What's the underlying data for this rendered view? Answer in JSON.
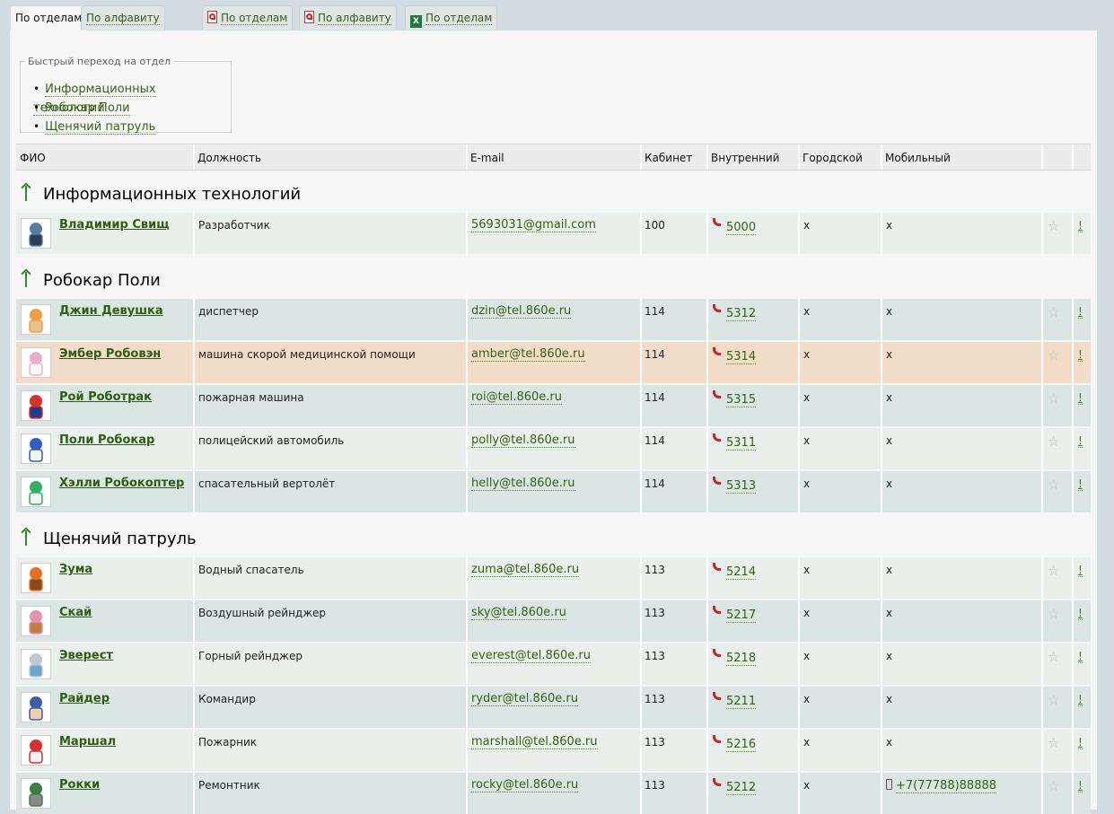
{
  "tabs": [
    {
      "label": "По отделам",
      "active": true
    },
    {
      "label": "По алфавиту"
    },
    {
      "label": "По отделам",
      "icon": "pdf-icon"
    },
    {
      "label": "По алфавиту",
      "icon": "pdf-icon"
    },
    {
      "label": "По отделам",
      "icon": "excel-icon"
    }
  ],
  "quick_nav": {
    "legend": "Быстрый переход на отдел",
    "items": [
      "Информационных технологий",
      "Робокар Поли",
      "Щенячий патруль"
    ]
  },
  "columns": [
    "ФИО",
    "Должность",
    "E-mail",
    "Кабинет",
    "Внутренний",
    "Городской",
    "Мобильный"
  ],
  "departments": [
    {
      "name": "Информационных технологий",
      "people": [
        {
          "name": "Владимир Свищ",
          "position": "Разработчик",
          "email": "5693031@gmail.com",
          "room": "100",
          "ext": "5000",
          "city": "x",
          "mobile": "x"
        }
      ]
    },
    {
      "name": "Робокар Поли",
      "people": [
        {
          "name": "Джин Девушка",
          "position": "диспетчер",
          "email": "dzin@tel.860e.ru",
          "room": "114",
          "ext": "5312",
          "city": "x",
          "mobile": "x"
        },
        {
          "name": "Эмбер Робовэн",
          "position": "машина скорой медицинской помощи",
          "email": "amber@tel.860e.ru",
          "room": "114",
          "ext": "5314",
          "city": "x",
          "mobile": "x"
        },
        {
          "name": "Рой Роботрак",
          "position": "пожарная машина",
          "email": "roi@tel.860e.ru",
          "room": "114",
          "ext": "5315",
          "city": "x",
          "mobile": "x"
        },
        {
          "name": "Поли Робокар",
          "position": "полицейский автомобиль",
          "email": "polly@tel.860e.ru",
          "room": "114",
          "ext": "5311",
          "city": "x",
          "mobile": "x"
        },
        {
          "name": "Хэлли Робокоптер",
          "position": "спасательный вертолёт",
          "email": "helly@tel.860e.ru",
          "room": "114",
          "ext": "5313",
          "city": "x",
          "mobile": "x"
        }
      ]
    },
    {
      "name": "Щенячий патруль",
      "people": [
        {
          "name": "Зума",
          "position": "Водный спасатель",
          "email": "zuma@tel.860e.ru",
          "room": "113",
          "ext": "5214",
          "city": "x",
          "mobile": "x"
        },
        {
          "name": "Скай",
          "position": "Воздушный рейнджер",
          "email": "sky@tel.860e.ru",
          "room": "113",
          "ext": "5217",
          "city": "x",
          "mobile": "x"
        },
        {
          "name": "Эверест",
          "position": "Горный рейнджер",
          "email": "everest@tel.860e.ru",
          "room": "113",
          "ext": "5218",
          "city": "x",
          "mobile": "x"
        },
        {
          "name": "Райдер",
          "position": "Командир",
          "email": "ryder@tel.860e.ru",
          "room": "113",
          "ext": "5211",
          "city": "x",
          "mobile": "x"
        },
        {
          "name": "Маршал",
          "position": "Пожарник",
          "email": "marshall@tel.860e.ru",
          "room": "113",
          "ext": "5216",
          "city": "x",
          "mobile": "x"
        },
        {
          "name": "Рокки",
          "position": "Ремонтник",
          "email": "rocky@tel.860e.ru",
          "room": "113",
          "ext": "5212",
          "city": "x",
          "mobile": "+7(77788)88888"
        }
      ]
    }
  ],
  "favorite_symbol": "☆",
  "report_symbol": "!",
  "colors": {
    "link": "#356312",
    "row_a": "#e9efea",
    "row_b": "#d9e6e3",
    "row_highlight": "#f2dcc8",
    "phone_icon": "#cc2222"
  }
}
